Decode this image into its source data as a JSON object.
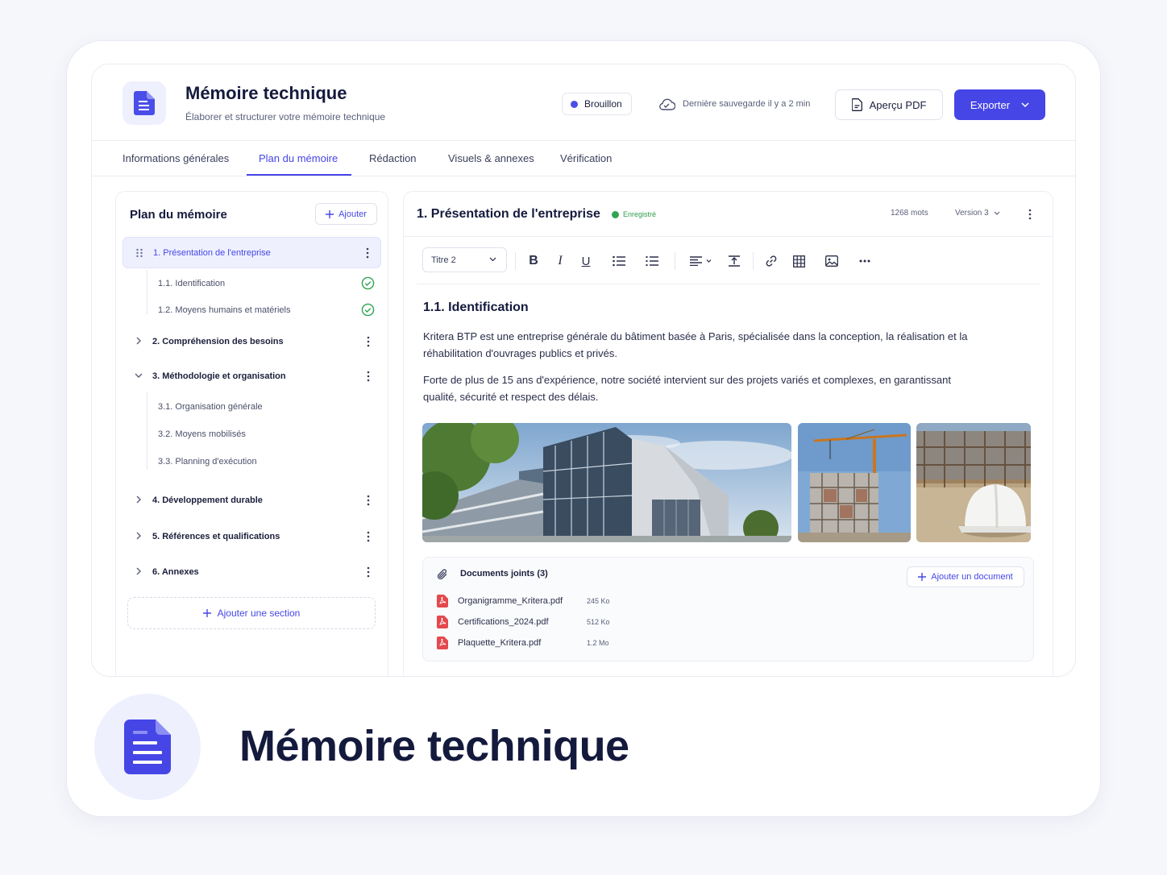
{
  "app": {
    "title": "Mémoire technique",
    "subtitle": "Élaborer et structurer votre mémoire technique",
    "status": "Brouillon",
    "save_status": "Dernière sauvegarde il y a 2 min",
    "pdf_button": "Aperçu PDF",
    "export_button": "Exporter",
    "accent_color": "#4646e6"
  },
  "tabs": [
    {
      "label": "Informations générales",
      "active": false
    },
    {
      "label": "Plan du mémoire",
      "active": true
    },
    {
      "label": "Rédaction",
      "active": false
    },
    {
      "label": "Visuels & annexes",
      "active": false
    },
    {
      "label": "Vérification",
      "active": false
    }
  ],
  "sidebar": {
    "title": "Plan du mémoire",
    "add_button": "Ajouter",
    "items": [
      {
        "label": "1. Présentation de l'entreprise",
        "state": "active",
        "children": [
          {
            "label": "1.1.  Identification",
            "done": true
          },
          {
            "label": "1.2.  Moyens humains et matériels",
            "done": true
          }
        ]
      },
      {
        "label": "2. Compréhension des besoins",
        "state": "collapsed"
      },
      {
        "label": "3. Méthodologie et organisation",
        "state": "expanded",
        "children": [
          {
            "label": "3.1.  Organisation générale"
          },
          {
            "label": "3.2.  Moyens mobilisés"
          },
          {
            "label": "3.3.  Planning d'exécution"
          }
        ]
      },
      {
        "label": "4. Développement durable",
        "state": "collapsed"
      },
      {
        "label": "5. Références et qualifications",
        "state": "collapsed"
      },
      {
        "label": "6. Annexes",
        "state": "collapsed"
      }
    ],
    "add_section": "Ajouter une section"
  },
  "editor": {
    "section_title": "1. Présentation de l'entreprise",
    "saved_label": "Enregistré",
    "word_count": "1268 mots",
    "version": "Version 3",
    "style_select": "Titre 2",
    "heading": "1.1. Identification",
    "paragraphs": [
      "Kritera BTP est une entreprise générale du bâtiment basée à Paris, spécialisée dans la conception, la réalisation et la réhabilitation d'ouvrages publics et privés.",
      "Forte de plus de 15 ans d'expérience, notre société intervient sur des projets variés et complexes, en garantissant qualité, sécurité et respect des délais."
    ],
    "images": [
      "modern-office-building",
      "construction-site-crane",
      "hard-hat-on-site"
    ]
  },
  "documents": {
    "title": "Documents joints (3)",
    "add_button": "Ajouter un document",
    "files": [
      {
        "name": "Organigramme_Kritera.pdf",
        "size": "245 Ko"
      },
      {
        "name": "Certifications_2024.pdf",
        "size": "512 Ko"
      },
      {
        "name": "Plaquette_Kritera.pdf",
        "size": "1.2 Mo"
      }
    ]
  },
  "footer": {
    "title": "Mémoire technique"
  }
}
